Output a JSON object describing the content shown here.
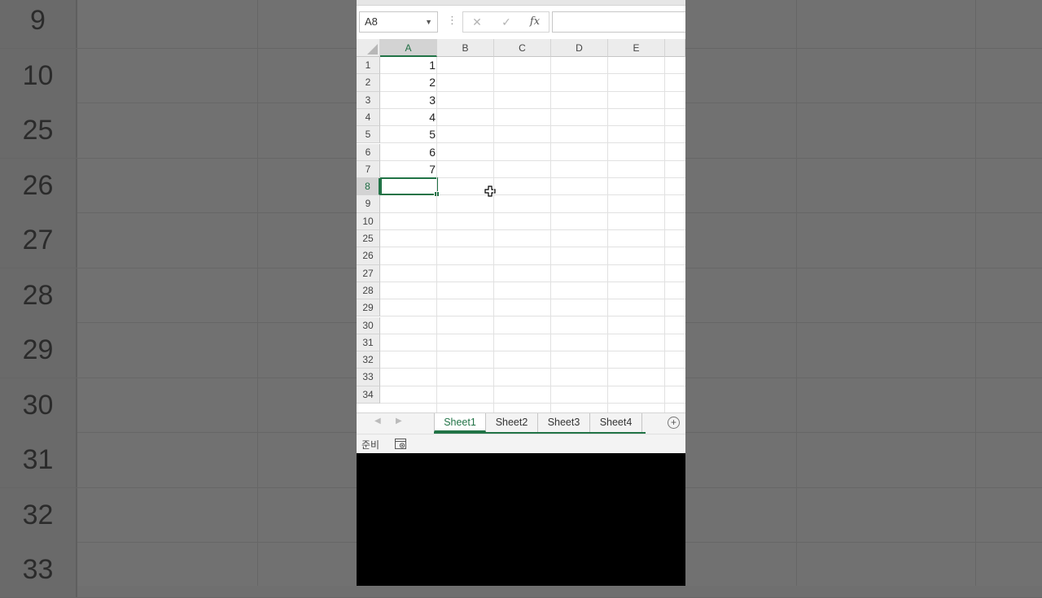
{
  "background": {
    "row_labels": [
      "9",
      "10",
      "25",
      "26",
      "27",
      "28",
      "29",
      "30",
      "31",
      "32",
      "33"
    ]
  },
  "formula_bar": {
    "name_box": "A8",
    "cancel_icon": "close-icon",
    "confirm_icon": "check-icon",
    "fx_label": "fx",
    "formula": ""
  },
  "sheet": {
    "columns": [
      "A",
      "B",
      "C",
      "D",
      "E"
    ],
    "active_column": "A",
    "row_labels": [
      "1",
      "2",
      "3",
      "4",
      "5",
      "6",
      "7",
      "8",
      "9",
      "10",
      "25",
      "26",
      "27",
      "28",
      "29",
      "30",
      "31",
      "32",
      "33",
      "34"
    ],
    "active_row": "8",
    "col_a_values": [
      "1",
      "2",
      "3",
      "4",
      "5",
      "6",
      "7",
      "",
      "",
      "",
      "",
      "",
      "",
      "",
      "",
      "",
      "",
      "",
      "",
      ""
    ]
  },
  "tabs": {
    "sheets": [
      "Sheet1",
      "Sheet2",
      "Sheet3",
      "Sheet4"
    ],
    "active": "Sheet1"
  },
  "status": {
    "text": "준비"
  },
  "colors": {
    "accent": "#217346",
    "header_bg": "#ececec",
    "grid_line": "#e1e1e1"
  }
}
